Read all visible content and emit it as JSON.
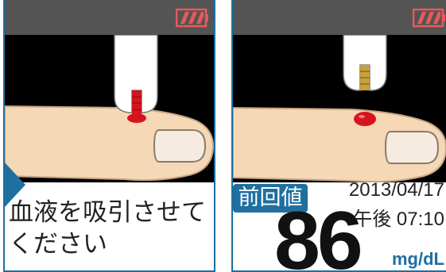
{
  "left_panel": {
    "instruction": "血液を吸引させてください"
  },
  "right_panel": {
    "previous_label": "前回値",
    "date": "2013/04/17",
    "time": "午後 07:10",
    "reading": "86",
    "unit": "mg/dL"
  },
  "colors": {
    "accent": "#1f6fa0",
    "battery": "#e8595a",
    "blood": "#d6141f",
    "skin": "#f5d8b5"
  },
  "icons": [
    "battery-icon",
    "arrow-right-icon"
  ]
}
